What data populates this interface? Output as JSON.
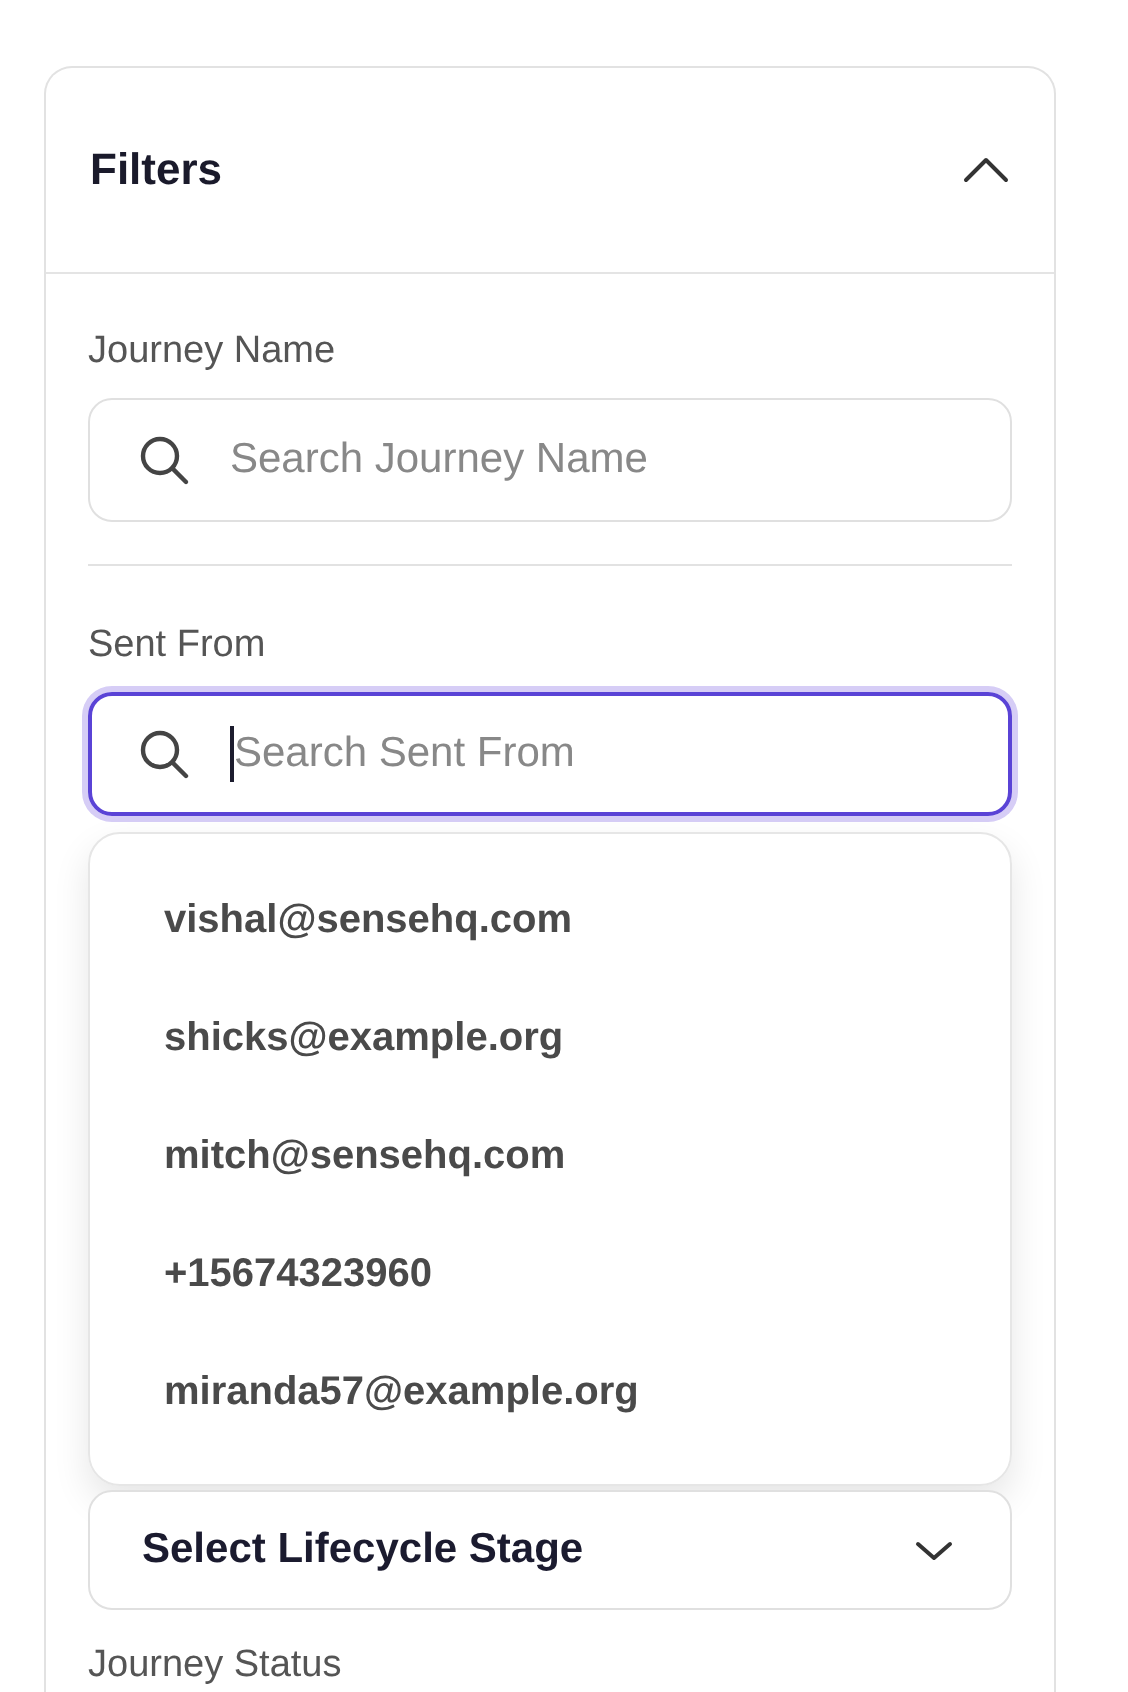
{
  "panel": {
    "title": "Filters",
    "expanded": true
  },
  "filters": [
    {
      "kind": "search",
      "label": "Journey Name",
      "placeholder": "Search Journey Name",
      "focused": false
    },
    {
      "kind": "divider"
    },
    {
      "kind": "search",
      "label": "Sent From",
      "placeholder": "Search Sent From",
      "focused": true,
      "options": [
        {
          "label": "vishal@sensehq.com"
        },
        {
          "label": "shicks@example.org"
        },
        {
          "label": "mitch@sensehq.com"
        },
        {
          "label": "+15674323960"
        },
        {
          "label": "miranda57@example.org"
        }
      ]
    },
    {
      "kind": "select",
      "placeholder": "Select Lifecycle Stage"
    },
    {
      "kind": "heading",
      "label": "Journey Status"
    }
  ]
}
